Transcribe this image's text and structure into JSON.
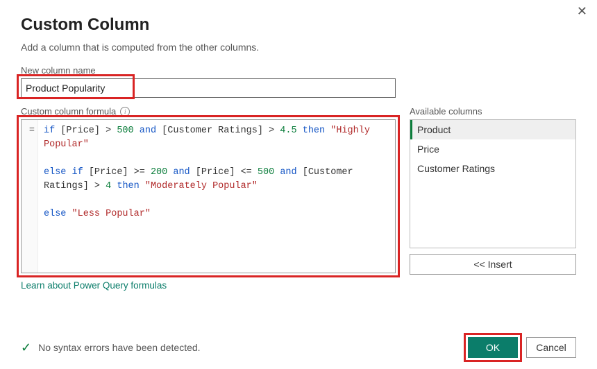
{
  "dialog": {
    "title": "Custom Column",
    "subtitle": "Add a column that is computed from the other columns.",
    "close_icon": "close"
  },
  "columnName": {
    "label": "New column name",
    "value": "Product Popularity"
  },
  "formula": {
    "label": "Custom column formula",
    "gutter": "=",
    "tokens": [
      {
        "t": "kw",
        "v": "if"
      },
      {
        "t": "txt",
        "v": " [Price] > "
      },
      {
        "t": "num",
        "v": "500"
      },
      {
        "t": "txt",
        "v": " "
      },
      {
        "t": "kw",
        "v": "and"
      },
      {
        "t": "txt",
        "v": " [Customer Ratings] > "
      },
      {
        "t": "num",
        "v": "4.5"
      },
      {
        "t": "txt",
        "v": " "
      },
      {
        "t": "kw",
        "v": "then"
      },
      {
        "t": "txt",
        "v": " "
      },
      {
        "t": "str",
        "v": "\"Highly Popular\""
      },
      {
        "t": "br"
      },
      {
        "t": "br"
      },
      {
        "t": "kw",
        "v": "else"
      },
      {
        "t": "txt",
        "v": " "
      },
      {
        "t": "kw",
        "v": "if"
      },
      {
        "t": "txt",
        "v": " [Price] >= "
      },
      {
        "t": "num",
        "v": "200"
      },
      {
        "t": "txt",
        "v": " "
      },
      {
        "t": "kw",
        "v": "and"
      },
      {
        "t": "txt",
        "v": " [Price] <= "
      },
      {
        "t": "num",
        "v": "500"
      },
      {
        "t": "txt",
        "v": " "
      },
      {
        "t": "kw",
        "v": "and"
      },
      {
        "t": "txt",
        "v": " [Customer Ratings] > "
      },
      {
        "t": "num",
        "v": "4"
      },
      {
        "t": "txt",
        "v": " "
      },
      {
        "t": "kw",
        "v": "then"
      },
      {
        "t": "txt",
        "v": " "
      },
      {
        "t": "str",
        "v": "\"Moderately Popular\""
      },
      {
        "t": "br"
      },
      {
        "t": "br"
      },
      {
        "t": "kw",
        "v": "else"
      },
      {
        "t": "txt",
        "v": " "
      },
      {
        "t": "str",
        "v": "\"Less Popular\""
      }
    ]
  },
  "available": {
    "label": "Available columns",
    "items": [
      "Product",
      "Price",
      "Customer Ratings"
    ],
    "selectedIndex": 0,
    "insert_label": "<< Insert"
  },
  "link": {
    "learn": "Learn about Power Query formulas"
  },
  "status": {
    "text": "No syntax errors have been detected."
  },
  "buttons": {
    "ok": "OK",
    "cancel": "Cancel"
  }
}
